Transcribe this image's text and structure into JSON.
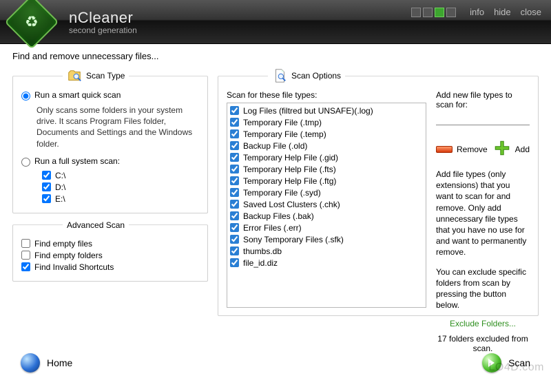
{
  "header": {
    "title": "nCleaner",
    "subtitle": "second generation",
    "links": {
      "info": "info",
      "hide": "hide",
      "close": "close"
    }
  },
  "intro": "Find and remove unnecessary files...",
  "scan_type": {
    "legend": "Scan Type",
    "quick_label": "Run a smart quick scan",
    "quick_desc": "Only scans some folders in your system drive. It scans Program Files folder, Documents and Settings and the Windows folder.",
    "full_label": "Run a full system scan:",
    "drives": [
      "C:\\",
      "D:\\",
      "E:\\"
    ],
    "selected": "quick",
    "drive_checked": [
      true,
      true,
      true
    ]
  },
  "advanced": {
    "legend": "Advanced Scan",
    "items": [
      {
        "label": "Find empty files",
        "checked": false
      },
      {
        "label": "Find empty folders",
        "checked": false
      },
      {
        "label": "Find Invalid Shortcuts",
        "checked": true
      }
    ]
  },
  "scan_options": {
    "legend": "Scan Options",
    "list_label": "Scan for these file types:",
    "file_types": [
      {
        "label": "Log Files (filtred but UNSAFE)(.log)",
        "checked": true
      },
      {
        "label": "Temporary File (.tmp)",
        "checked": true
      },
      {
        "label": "Temporary File (.temp)",
        "checked": true
      },
      {
        "label": "Backup File (.old)",
        "checked": true
      },
      {
        "label": "Temporary Help File (.gid)",
        "checked": true
      },
      {
        "label": "Temporary Help File (.fts)",
        "checked": true
      },
      {
        "label": "Temporary Help File (.ftg)",
        "checked": true
      },
      {
        "label": "Temporary File (.syd)",
        "checked": true
      },
      {
        "label": "Saved Lost Clusters (.chk)",
        "checked": true
      },
      {
        "label": "Backup Files (.bak)",
        "checked": true
      },
      {
        "label": "Error Files (.err)",
        "checked": true
      },
      {
        "label": "Sony Temporary Files (.sfk)",
        "checked": true
      },
      {
        "label": "thumbs.db",
        "checked": true
      },
      {
        "label": "file_id.diz",
        "checked": true
      }
    ],
    "add_label": "Add new file types to scan for:",
    "add_value": "",
    "remove_btn": "Remove",
    "add_btn": "Add",
    "help1": "Add file types (only extensions) that you want to scan for and remove. Only add unnecessary file types that you have no use for and want to permanently remove.",
    "help2": "You can exclude specific folders from scan by pressing the button below.",
    "exclude_link": "Exclude Folders...",
    "excluded_text": "17 folders excluded from scan."
  },
  "footer": {
    "home": "Home",
    "scan": "Scan"
  },
  "watermark": "LO4D.com"
}
